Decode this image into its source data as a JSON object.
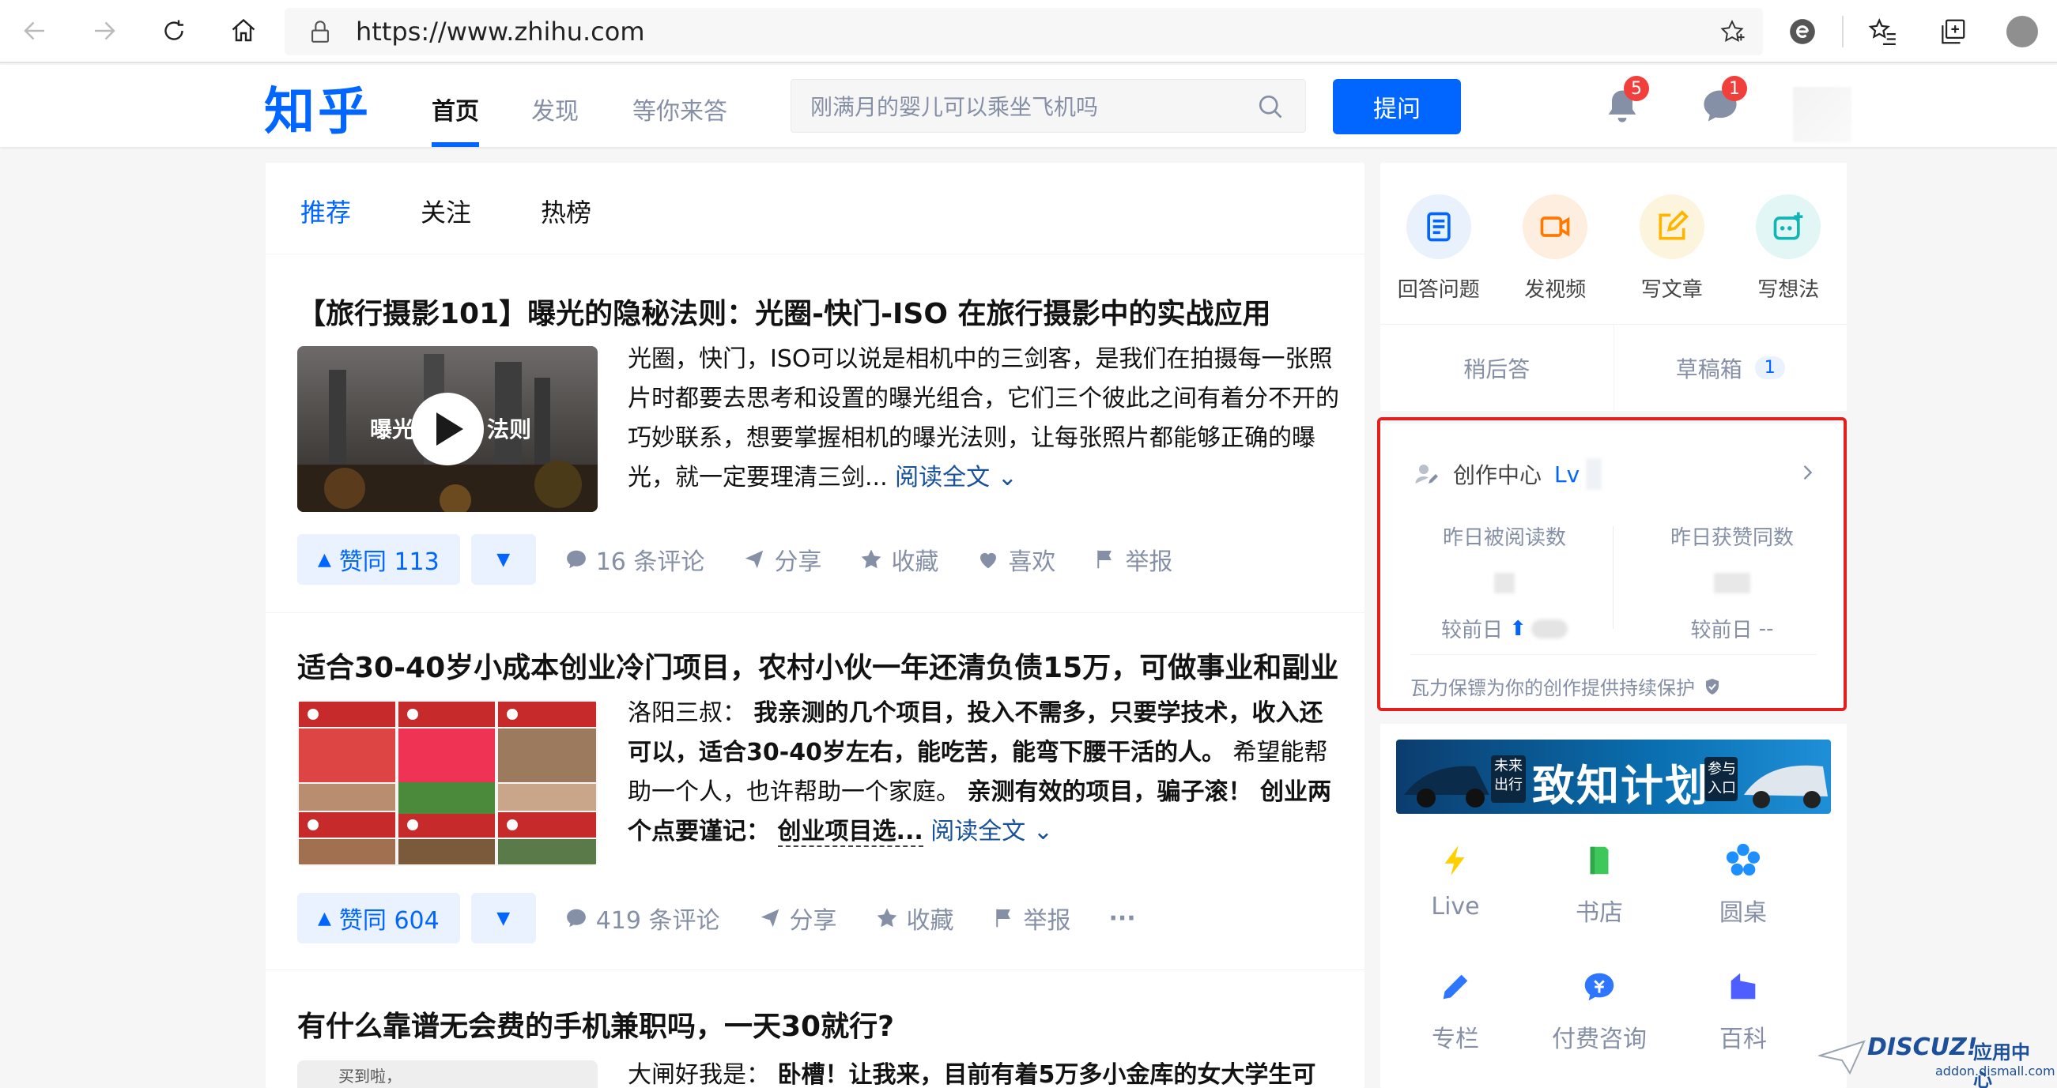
{
  "browser": {
    "url": "https://www.zhihu.com"
  },
  "header": {
    "logo": "知乎",
    "tabs": [
      {
        "label": "首页",
        "active": true
      },
      {
        "label": "发现",
        "active": false
      },
      {
        "label": "等你来答",
        "active": false
      }
    ],
    "search_placeholder": "刚满月的婴儿可以乘坐飞机吗",
    "ask_label": "提问",
    "notifications_count": "5",
    "messages_count": "1",
    "accent_color": "#0066ff"
  },
  "feed": {
    "tabs": [
      "推荐",
      "关注",
      "热榜"
    ],
    "items": [
      {
        "title": "【旅行摄影101】曝光的隐秘法则：光圈-快门-ISO 在旅行摄影中的实战应用",
        "thumb_caption": "曝光",
        "thumb_caption2": "法则",
        "excerpt": "光圈，快门，ISO可以说是相机中的三剑客，是我们在拍摄每一张照片时都要去思考和设置的曝光组合，它们三个彼此之间有着分不开的巧妙联系，想要掌握相机的曝光法则，让每张照片都能够正确的曝光，就一定要理清三剑...",
        "read_more": "阅读全文",
        "vote": "赞同 113",
        "comments": "16 条评论",
        "share": "分享",
        "favorite": "收藏",
        "like": "喜欢",
        "report": "举报"
      },
      {
        "title": "适合30-40岁小成本创业冷门项目，农村小伙一年还清负债15万，可做事业和副业",
        "author": "洛阳三叔：",
        "excerpt_b1": "我亲测的几个项目，投入不需多，只要学技术，收入还可以，适合30-40岁左右，能吃苦，能弯下腰干活的人。",
        "excerpt_n1": "希望能帮助一个人，也许帮助一个家庭。",
        "excerpt_b2": "亲测有效的项目，骗子滚！ 创业两个点要谨记：",
        "excerpt_u": "创业项目选...",
        "read_more": "阅读全文",
        "vote": "赞同 604",
        "comments": "419 条评论",
        "share": "分享",
        "favorite": "收藏",
        "report": "举报",
        "more": "···"
      },
      {
        "title": "有什么靠谱无会费的手机兼职吗，一天30就行?",
        "thumb_caption": "买到啦，",
        "excerpt_n": "大闸好我是：",
        "excerpt_b": "卧槽！让我来，目前有着5万多小金库的女大学生可"
      }
    ]
  },
  "creator": {
    "actions": [
      {
        "label": "回答问题",
        "icon": "answer-icon",
        "bg": "#e8f1fc",
        "color": "#0066ff"
      },
      {
        "label": "发视频",
        "icon": "video-icon",
        "bg": "#fdeedf",
        "color": "#ff7800"
      },
      {
        "label": "写文章",
        "icon": "write-icon",
        "bg": "#fdf4dd",
        "color": "#ffb400"
      },
      {
        "label": "写想法",
        "icon": "idea-icon",
        "bg": "#e2f6f6",
        "color": "#11b5b5"
      }
    ],
    "later": "稍后答",
    "drafts": "草稿箱",
    "drafts_count": "1"
  },
  "center": {
    "title": "创作中心",
    "level": "Lv",
    "read_label": "昨日被阅读数",
    "upvote_label": "昨日获赞同数",
    "compare": "较前日",
    "upvote_compare": "--",
    "protect": "瓦力保镖为你的创作提供持续保护"
  },
  "banner": {
    "tag1": "未来",
    "tag2": "出行",
    "title": "致知计划",
    "tag3": "参与",
    "tag4": "入口"
  },
  "apps": [
    {
      "label": "Live",
      "icon": "lightning-icon",
      "color": "#ffcf00"
    },
    {
      "label": "书店",
      "icon": "book-icon",
      "color": "#3ec85c"
    },
    {
      "label": "圆桌",
      "icon": "roundtable-icon",
      "color": "#1e8fff"
    },
    {
      "label": "专栏",
      "icon": "pen-icon",
      "color": "#2e75ff"
    },
    {
      "label": "付费咨询",
      "icon": "consult-icon",
      "color": "#2e75ff"
    },
    {
      "label": "百科",
      "icon": "encyclopedia-icon",
      "color": "#4f5fff"
    }
  ],
  "watermark": {
    "brand": "DISCUZ!",
    "sub": "应用中心",
    "domain": "addon.dismall.com"
  }
}
